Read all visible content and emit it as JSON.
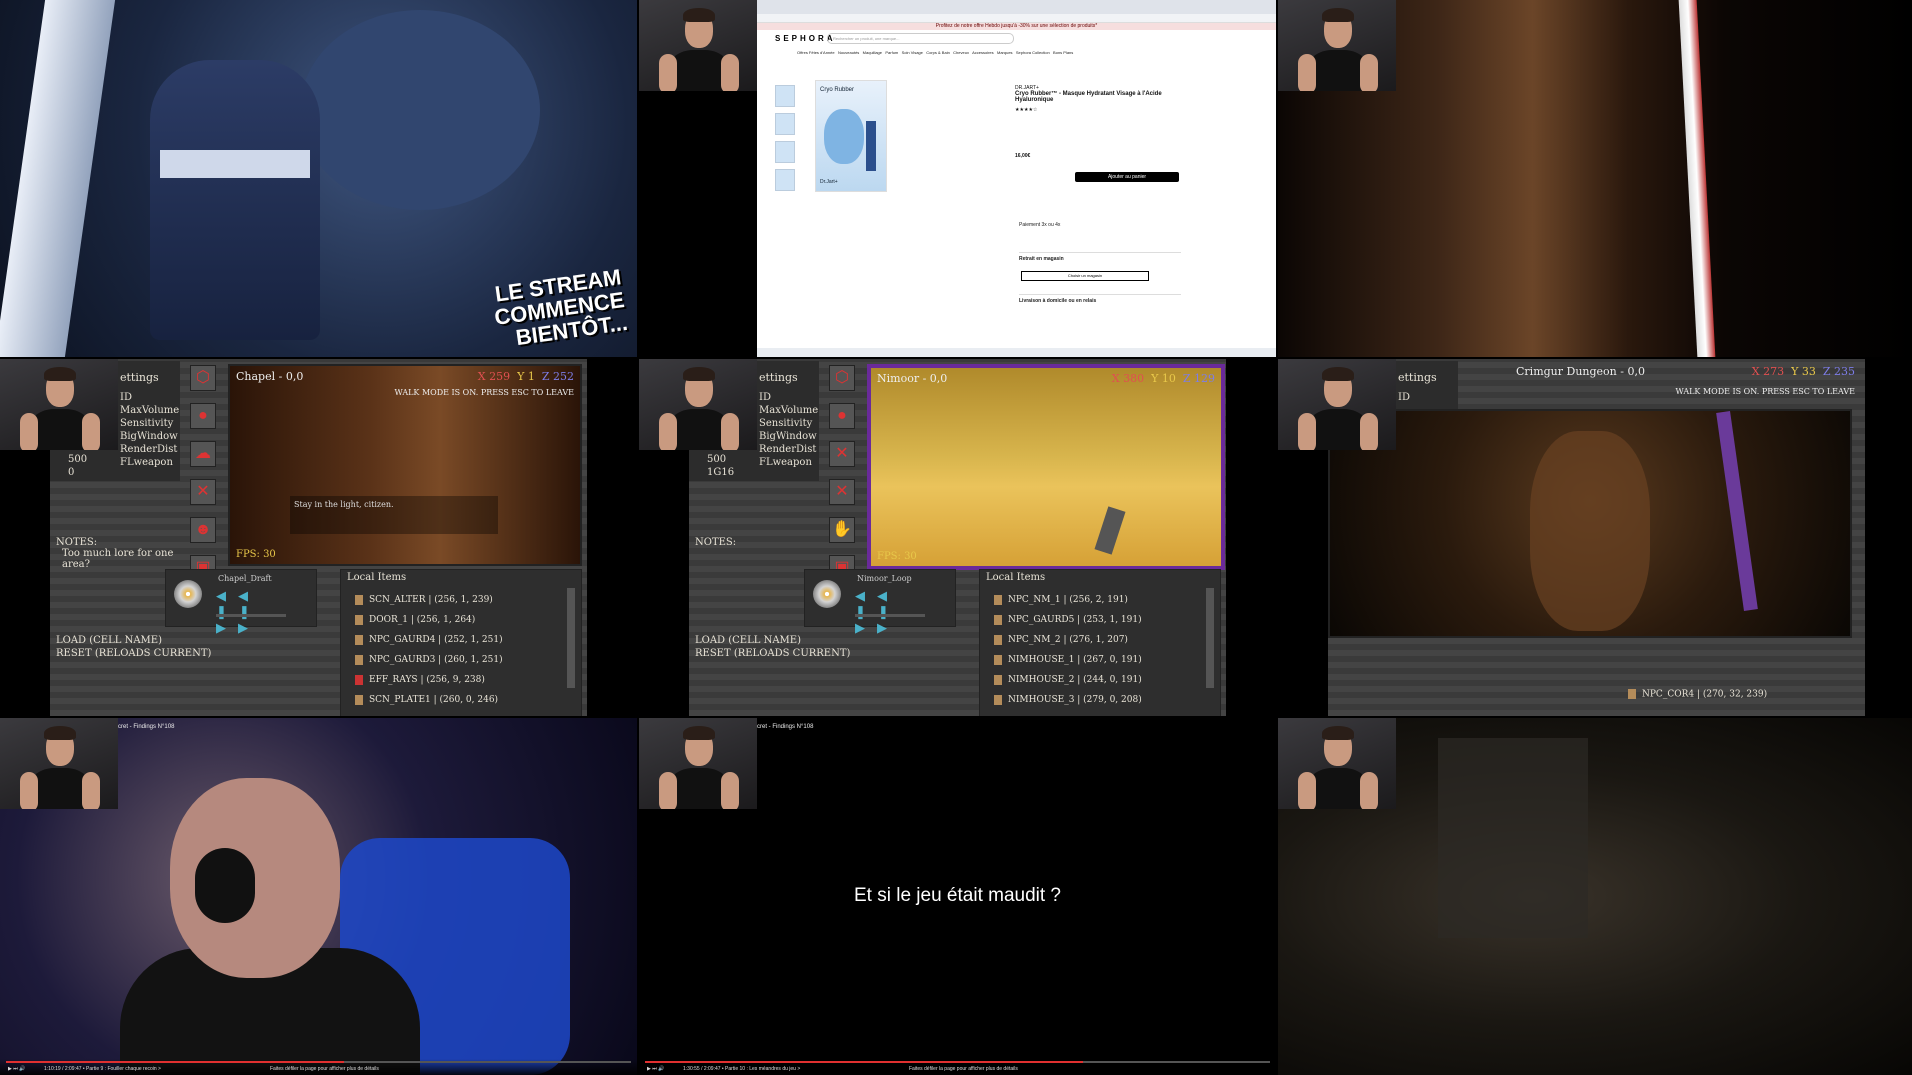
{
  "tile0": {
    "banner": [
      "LE STREAM",
      "COMMENCE",
      "BIENTÔT..."
    ]
  },
  "tile1": {
    "promo": "Profitez de notre offre Hebdo jusqu'à -30% sur une sélection de produits*",
    "logo": "SEPHORA",
    "search_placeholder": "Rechercher un produit, une marque...",
    "nav": [
      "Offres Fêtes d'Année",
      "Nouveautés",
      "Maquillage",
      "Parfum",
      "Soin Visage",
      "Corps & Bain",
      "Cheveux",
      "Accessoires",
      "Marques",
      "Sephora Collection",
      "Bons Plans"
    ],
    "brand": "DR.JART+",
    "title": "Cryo Rubber™ - Masque Hydratant Visage à l'Acide Hyaluronique",
    "price": "16,00€",
    "cta": "Ajouter au panier",
    "payment": "Paiement 3x ou 4x",
    "store": "Retrait en magasin",
    "store_btn": "Choisir un magasin",
    "delivery": "Livraison à domicile ou en relais",
    "product_label": "Cryo Rubber",
    "product_brand": "Dr.Jart+"
  },
  "game_settings": {
    "title": "ettings",
    "options": [
      "ID",
      "MaxVolume",
      "Sensitivity",
      "BigWindow",
      "RenderDist",
      "FLweapon"
    ]
  },
  "tile3": {
    "values": [
      "500",
      "0"
    ],
    "viewport_title": "Chapel - 0,0",
    "coords": {
      "x": "X 259",
      "y": "Y 1",
      "z": "Z 252"
    },
    "walk_mode": "WALK MODE IS ON. PRESS ESC TO LEAVE",
    "subtitle": "Stay in the light, citizen.",
    "fps": "FPS: 30",
    "notes_label": "NOTES:",
    "notes_text": "Too much lore for one area?",
    "track": "Chapel_Draft",
    "load": "LOAD (CELL NAME)",
    "reset": "RESET (RELOADS CURRENT)",
    "items_title": "Local Items",
    "items": [
      "SCN_ALTER | (256, 1, 239)",
      "DOOR_1 | (256, 1, 264)",
      "NPC_GAURD4 | (252, 1, 251)",
      "NPC_GAURD3 | (260, 1, 251)",
      "EFF_RAYS | (256, 9, 238)",
      "SCN_PLATE1 | (260, 0, 246)"
    ]
  },
  "tile4": {
    "values": [
      "500",
      "1G16"
    ],
    "viewport_title": "Nimoor - 0,0",
    "coords": {
      "x": "X 380",
      "y": "Y 10",
      "z": "Z 129"
    },
    "fps": "FPS: 30",
    "notes_label": "NOTES:",
    "track": "Nimoor_Loop",
    "load": "LOAD (CELL NAME)",
    "reset": "RESET (RELOADS CURRENT)",
    "items_title": "Local Items",
    "items": [
      "NPC_NM_1 | (256, 2, 191)",
      "NPC_GAURD5 | (253, 1, 191)",
      "NPC_NM_2 | (276, 1, 207)",
      "NIMHOUSE_1 | (267, 0, 191)",
      "NIMHOUSE_2 | (244, 0, 191)",
      "NIMHOUSE_3 | (279, 0, 208)"
    ]
  },
  "tile5": {
    "viewport_title": "Crimgur Dungeon - 0,0",
    "coords": {
      "x": "X 273",
      "y": "Y 33",
      "z": "Z 235"
    },
    "walk_mode": "WALK MODE IS ON. PRESS ESC TO LEAVE",
    "item": "NPC_COR4 | (270, 32, 239)"
  },
  "tile6": {
    "title": "cret - Findings N°108",
    "time": "1:10:19 / 2:09:47 • Partie 9 : Fouiller chaque recoin >",
    "hint": "Faites défiler la page pour afficher plus de détails",
    "progress": 0.54
  },
  "tile7": {
    "title": "cret - Findings N°108",
    "quote": "Et si le jeu était maudit ?",
    "time": "1:30:55 / 2:09:47 • Partie 10 : Les méandres du jeu >",
    "hint": "Faites défiler la page pour afficher plus de détails",
    "progress": 0.7
  },
  "colors": {
    "accent_red": "#e03030",
    "coord_x": "#e05050",
    "coord_y": "#e8c84a",
    "coord_z": "#7d7de8"
  }
}
